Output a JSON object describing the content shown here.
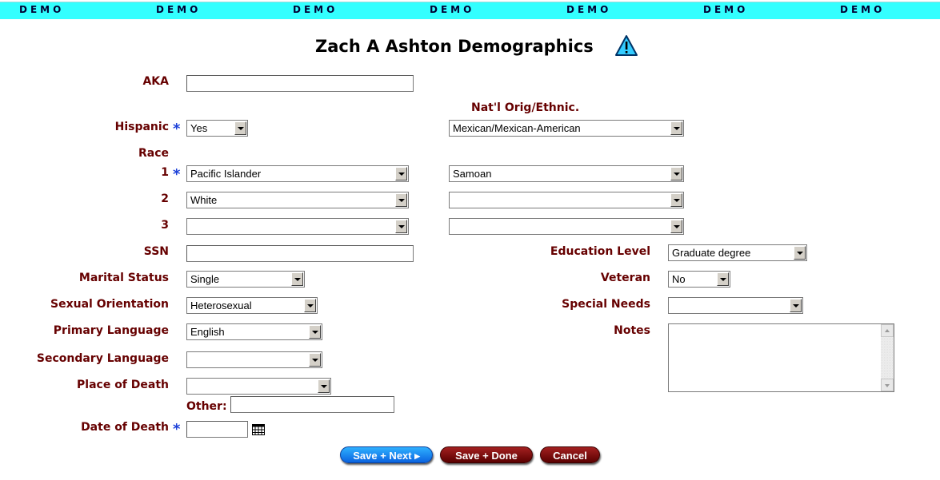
{
  "banner": [
    "DEMO",
    "DEMO",
    "DEMO",
    "DEMO",
    "DEMO",
    "DEMO",
    "DEMO"
  ],
  "page": {
    "title": "Zach A Ashton Demographics"
  },
  "labels": {
    "aka": "AKA",
    "natl_orig": "Nat'l Orig/Ethnic.",
    "hispanic": "Hispanic",
    "race": "Race",
    "race1": "1",
    "race2": "2",
    "race3": "3",
    "ssn": "SSN",
    "education": "Education Level",
    "marital": "Marital Status",
    "veteran": "Veteran",
    "sexual": "Sexual Orientation",
    "special": "Special Needs",
    "primary_lang": "Primary Language",
    "notes": "Notes",
    "secondary_lang": "Secondary Language",
    "place_death": "Place of Death",
    "other": "Other:",
    "date_death": "Date of Death"
  },
  "required_marker": "*",
  "fields": {
    "aka": "",
    "hispanic": "Yes",
    "natl_orig": "Mexican/Mexican-American",
    "race1": "Pacific Islander",
    "race1_detail": "Samoan",
    "race2": "White",
    "race2_detail": "",
    "race3": "",
    "race3_detail": "",
    "ssn": "",
    "education": "Graduate degree",
    "marital": "Single",
    "veteran": "No",
    "sexual": "Heterosexual",
    "special": "",
    "primary_lang": "English",
    "secondary_lang": "",
    "notes": "",
    "place_death": "",
    "other": "",
    "date_death": ""
  },
  "buttons": {
    "save_next": "Save + Next ▸",
    "save_done": "Save + Done",
    "cancel": "Cancel"
  },
  "icons": {
    "warning": "warning-triangle-icon",
    "calendar": "calendar-icon"
  },
  "colors": {
    "banner": "#33ffff",
    "label": "#660000",
    "required": "#1a3fd8"
  }
}
